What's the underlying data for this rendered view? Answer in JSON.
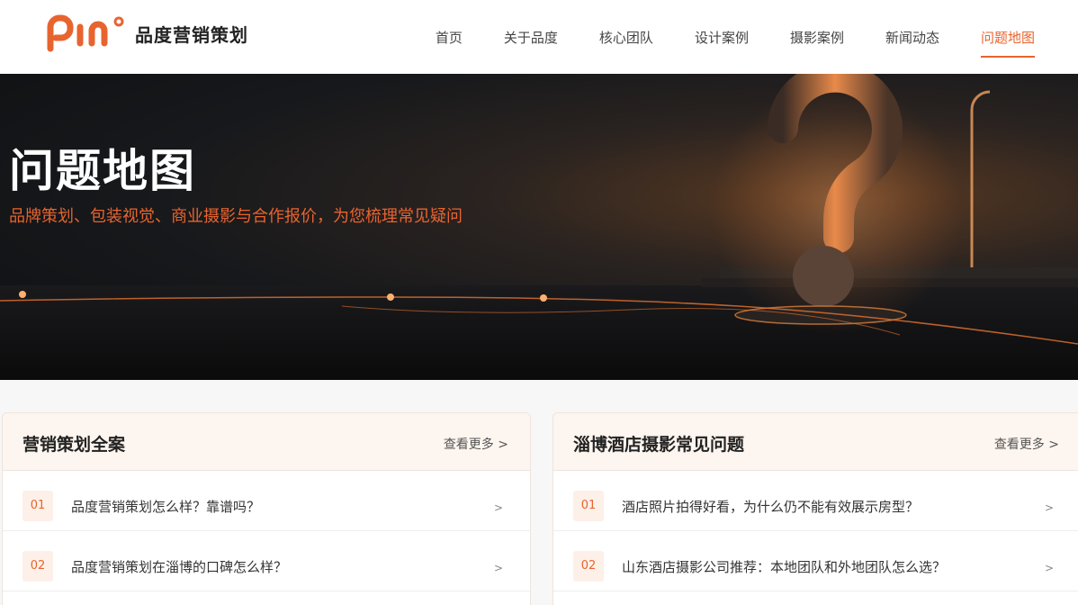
{
  "brand": {
    "name": "品度营销策划",
    "logo_color": "#e8642f"
  },
  "nav": {
    "items": [
      {
        "label": "首页",
        "active": false
      },
      {
        "label": "关于品度",
        "active": false
      },
      {
        "label": "核心团队",
        "active": false
      },
      {
        "label": "设计案例",
        "active": false
      },
      {
        "label": "摄影案例",
        "active": false
      },
      {
        "label": "新闻动态",
        "active": false
      },
      {
        "label": "问题地图",
        "active": true
      }
    ],
    "accent_color": "#e8642f"
  },
  "hero": {
    "title": "问题地图",
    "subtitle": "品牌策划、包装视觉、商业摄影与合作报价，为您梳理常见疑问"
  },
  "sections": [
    {
      "title": "营销策划全案",
      "more_label": "查看更多 >",
      "items": [
        {
          "num": "01",
          "text": "品度营销策划怎么样？靠谱吗？",
          "arrow": ">"
        },
        {
          "num": "02",
          "text": "品度营销策划在淄博的口碑怎么样？",
          "arrow": ">"
        }
      ]
    },
    {
      "title": "淄博酒店摄影常见问题",
      "more_label": "查看更多 >",
      "items": [
        {
          "num": "01",
          "text": "酒店照片拍得好看，为什么仍不能有效展示房型？",
          "arrow": ">"
        },
        {
          "num": "02",
          "text": "山东酒店摄影公司推荐：本地团队和外地团队怎么选？",
          "arrow": ">"
        }
      ]
    }
  ]
}
